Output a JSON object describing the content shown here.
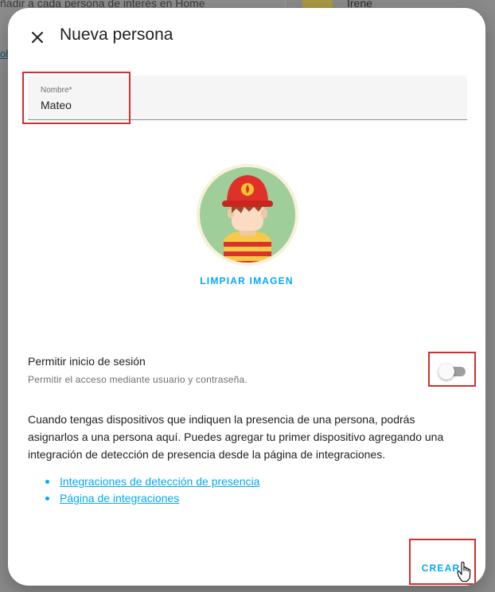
{
  "background": {
    "text": "ñadir a cada persona de interés en Home",
    "link": "ob",
    "person_name": "Irene"
  },
  "dialog": {
    "title": "Nueva persona",
    "close_icon": "close-icon",
    "name_field": {
      "label": "Nombre*",
      "value": "Mateo"
    },
    "avatar_icon": "firefighter-avatar-icon",
    "clear_image_label": "LIMPIAR IMAGEN",
    "login": {
      "title": "Permitir inicio de sesión",
      "subtitle": "Permitir el acceso mediante usuario y contraseña.",
      "enabled": false
    },
    "description": "Cuando tengas dispositivos que indiquen la presencia de una persona, podrás asignarlos a una persona aquí. Puedes agregar tu primer dispositivo agregando una integración de detección de presencia desde la página de integraciones.",
    "links": [
      "Integraciones de detección de presencia",
      "Página de integraciones"
    ],
    "create_label": "CREAR"
  },
  "colors": {
    "accent": "#03a9f4",
    "highlight": "#d32f2f"
  }
}
